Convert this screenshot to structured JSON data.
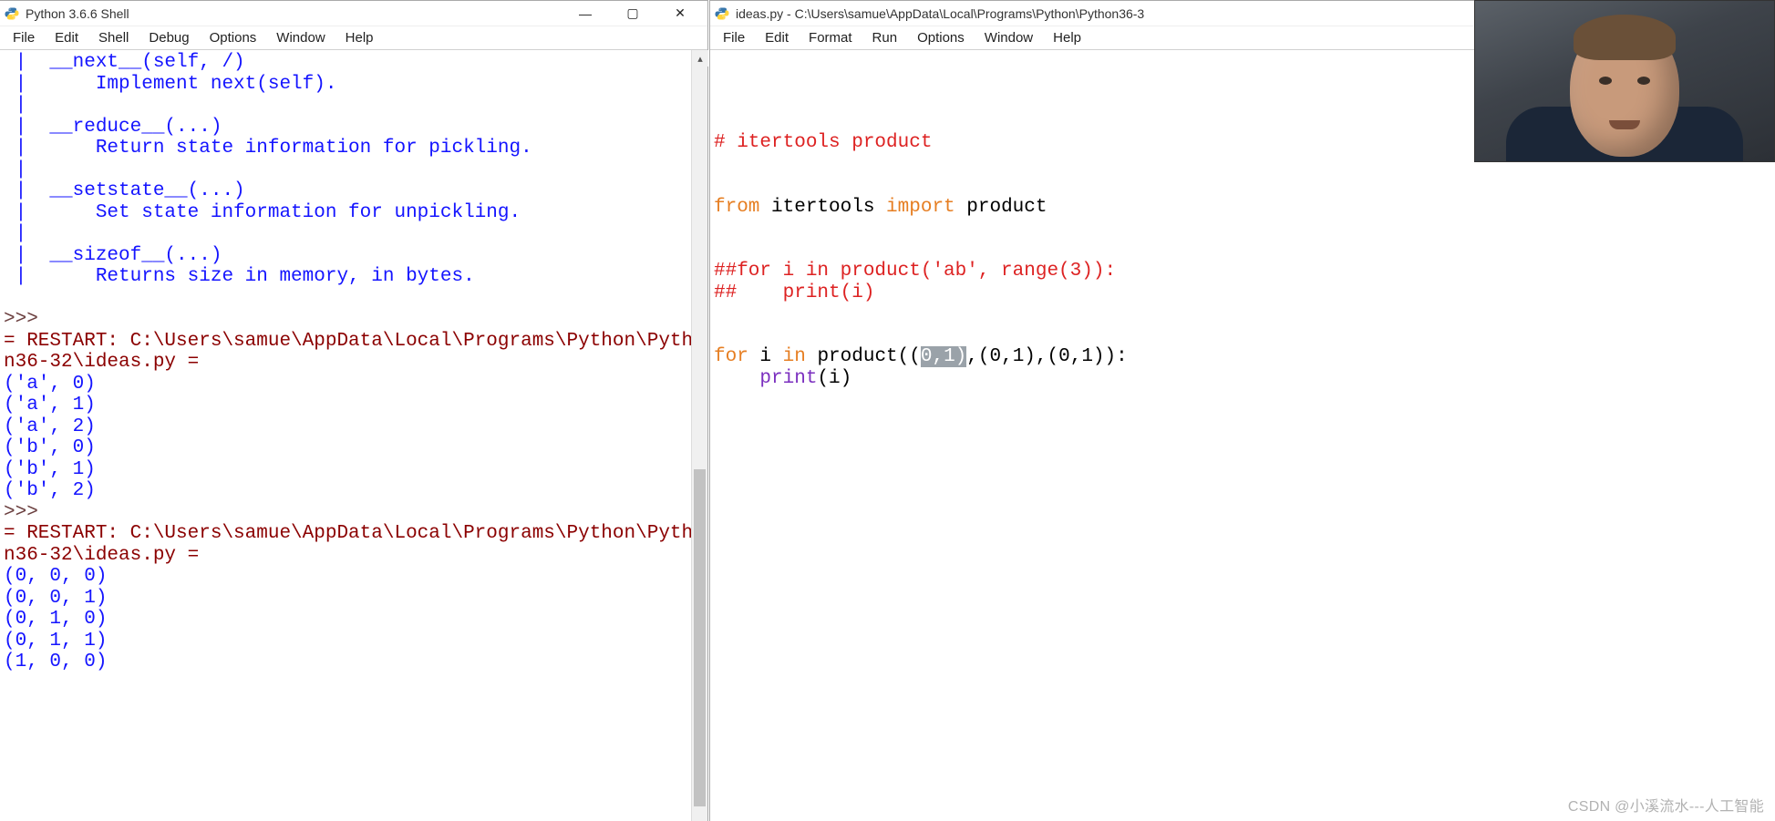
{
  "left": {
    "title": "Python 3.6.6 Shell",
    "menus": [
      "File",
      "Edit",
      "Shell",
      "Debug",
      "Options",
      "Window",
      "Help"
    ],
    "help_lines": [
      " |  __next__(self, /)",
      " |      Implement next(self).",
      " |",
      " |  __reduce__(...)",
      " |      Return state information for pickling.",
      " |",
      " |  __setstate__(...)",
      " |      Set state information for unpickling.",
      " |",
      " |  __sizeof__(...)",
      " |      Returns size in memory, in bytes.",
      ""
    ],
    "prompt1": ">>> ",
    "restart1a": "= RESTART: C:\\Users\\samue\\AppData\\Local\\Programs\\Python\\Pytho",
    "restart1b": "n36-32\\ideas.py =",
    "out1": [
      "('a', 0)",
      "('a', 1)",
      "('a', 2)",
      "('b', 0)",
      "('b', 1)",
      "('b', 2)"
    ],
    "prompt2": ">>> ",
    "restart2a": "= RESTART: C:\\Users\\samue\\AppData\\Local\\Programs\\Python\\Pytho",
    "restart2b": "n36-32\\ideas.py =",
    "out2": [
      "(0, 0, 0)",
      "(0, 0, 1)",
      "(0, 1, 0)",
      "(0, 1, 1)",
      "(1, 0, 0)"
    ]
  },
  "right": {
    "title": "ideas.py - C:\\Users\\samue\\AppData\\Local\\Programs\\Python\\Python36-3",
    "menus": [
      "File",
      "Edit",
      "Format",
      "Run",
      "Options",
      "Window",
      "Help"
    ],
    "c1": "# itertools product",
    "kw_from": "from",
    "mod": " itertools ",
    "kw_import": "import",
    "mod2": " product",
    "c2a": "##for i in product('ab', range(3)):",
    "c2b": "##    print(i)",
    "kw_for": "for",
    "loop_mid1": " i ",
    "kw_in": "in",
    "loop_mid2": " product((",
    "sel": "0,1)",
    "loop_rest": ",(0,1),(0,1)):",
    "print_indent": "    ",
    "builtin_print": "print",
    "print_args": "(i)"
  },
  "watermark": "CSDN @小溪流水---人工智能"
}
